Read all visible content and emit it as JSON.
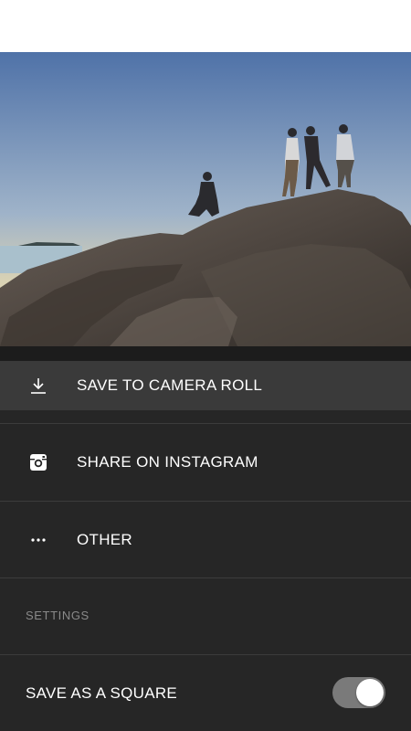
{
  "actions": {
    "save_label": "SAVE TO CAMERA ROLL",
    "instagram_label": "SHARE ON INSTAGRAM",
    "other_label": "OTHER"
  },
  "settings": {
    "header": "SETTINGS",
    "square_label": "SAVE AS A SQUARE",
    "square_enabled": true
  },
  "colors": {
    "sheet_background": "#262626",
    "highlight_row": "#3a3a3a",
    "toggle_track": "#7a7a7a"
  },
  "icons": {
    "save": "download-icon",
    "instagram": "instagram-icon",
    "other": "more-dots-icon"
  }
}
